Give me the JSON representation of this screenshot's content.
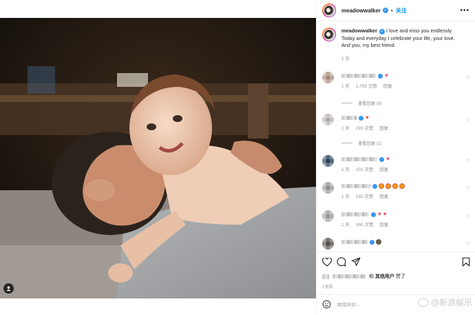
{
  "post": {
    "username": "meadowwalker",
    "follow_label": "关注",
    "more_label": "•••"
  },
  "caption": {
    "username": "meadowwalker",
    "text": "I love and miss you endlessly. Today and everyday I celebrate your life, your love. And you, my best friend.",
    "time": "1 天"
  },
  "comments": [
    {
      "time": "1 天",
      "likes": "1,755 次赞",
      "reply": "回复",
      "view_replies": "查看回复 (9)"
    },
    {
      "time": "1 天",
      "likes": "293 次赞",
      "reply": "回复",
      "view_replies": "查看回复 (1)"
    },
    {
      "time": "1 天",
      "likes": "202 次赞",
      "reply": "回复"
    },
    {
      "time": "1 天",
      "likes": "192 次赞",
      "reply": "回复"
    },
    {
      "time": "1 天",
      "likes": "160 次赞",
      "reply": "回复"
    },
    {
      "time": "",
      "likes": "",
      "reply": ""
    }
  ],
  "likes_line": {
    "connector": "和",
    "others": "其他用户",
    "suffix": "赞了"
  },
  "post_time": "1天前",
  "add_comment": {
    "placeholder": "添加评论..."
  },
  "watermark": "@新浪娱乐",
  "colors": {
    "accent": "#0095f6",
    "verified": "#3897f0",
    "heart": "#ed4956",
    "muted": "#8e8e8e"
  },
  "icons": [
    "more-icon",
    "verified-icon",
    "heart-icon",
    "comment-icon",
    "share-icon",
    "bookmark-icon",
    "emoji-icon",
    "user-tag-icon"
  ]
}
